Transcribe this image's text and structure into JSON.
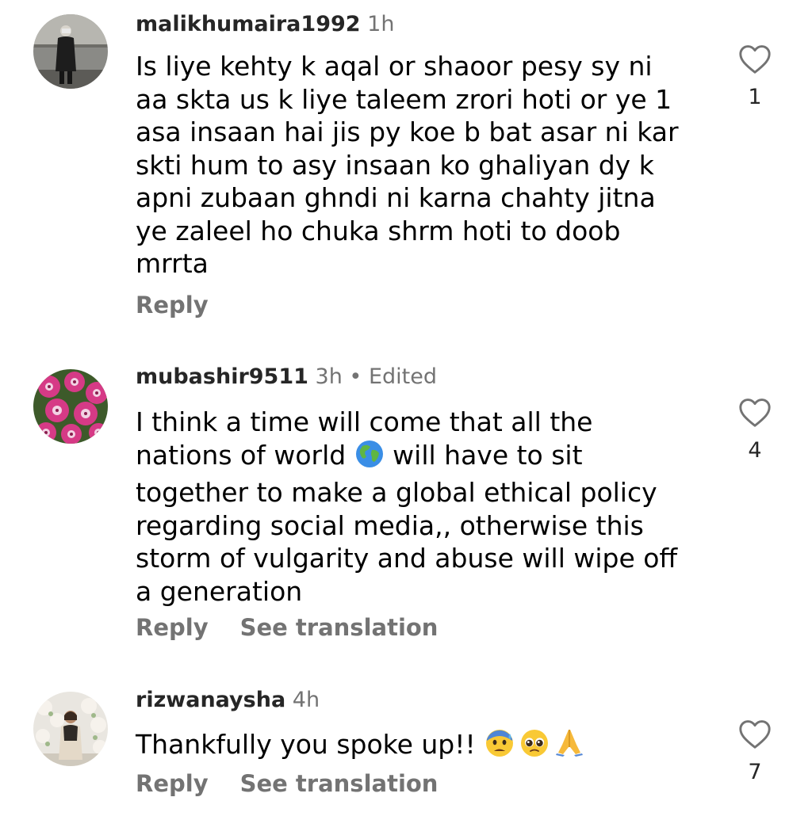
{
  "comments": [
    {
      "username": "malikhumaira1992",
      "time": "1h",
      "text": "Is liye kehty k aqal or shaoor pesy sy ni\naa skta us k liye taleem zrori hoti  or ye 1\nasa insaan hai jis py koe b bat asar ni kar\nskti hum to asy insaan ko ghaliyan dy k\napni zubaan ghndi ni karna chahty jitna\nye zaleel ho chuka  shrm hoti to doob\nmrrta",
      "reply_label": "Reply",
      "likes": "1"
    },
    {
      "username": "mubashir9511",
      "time": "3h",
      "separator": "•",
      "edited_label": "Edited",
      "text_part1": "I think a time will come that all the\nnations of world ",
      "emoji": "globe-europe-africa",
      "text_part2": " will have to sit\ntogether to make a global ethical policy\nregarding social media,, otherwise this\nstorm of vulgarity and abuse will wipe off\na generation",
      "reply_label": "Reply",
      "translate_label": "See translation",
      "likes": "4"
    },
    {
      "username": "rizwanaysha",
      "time": "4h",
      "text": "Thankfully you spoke up!! ",
      "emojis": [
        "anxious-face-with-sweat",
        "pleading-face",
        "folded-hands"
      ],
      "reply_label": "Reply",
      "translate_label": "See translation",
      "likes": "7"
    }
  ],
  "colors": {
    "text": "#000000",
    "username": "#262626",
    "secondary": "#737373"
  }
}
